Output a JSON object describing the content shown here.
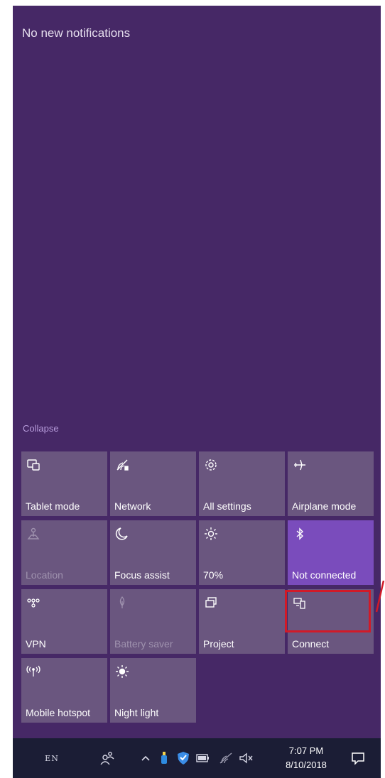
{
  "notifications": {
    "header": "No new notifications"
  },
  "collapse_label": "Collapse",
  "quick_actions": [
    {
      "label": "Tablet mode",
      "icon": "tablet-mode-icon",
      "state": "default"
    },
    {
      "label": "Network",
      "icon": "network-icon",
      "state": "default"
    },
    {
      "label": "All settings",
      "icon": "gear-icon",
      "state": "default"
    },
    {
      "label": "Airplane mode",
      "icon": "airplane-icon",
      "state": "default"
    },
    {
      "label": "Location",
      "icon": "location-icon",
      "state": "disabled"
    },
    {
      "label": "Focus assist",
      "icon": "moon-icon",
      "state": "default"
    },
    {
      "label": "70%",
      "icon": "brightness-icon",
      "state": "default"
    },
    {
      "label": "Not connected",
      "icon": "bluetooth-icon",
      "state": "active"
    },
    {
      "label": "VPN",
      "icon": "vpn-icon",
      "state": "default"
    },
    {
      "label": "Battery saver",
      "icon": "battery-saver-icon",
      "state": "disabled"
    },
    {
      "label": "Project",
      "icon": "project-icon",
      "state": "default"
    },
    {
      "label": "Connect",
      "icon": "connect-icon",
      "state": "default",
      "highlighted": true
    },
    {
      "label": "Mobile hotspot",
      "icon": "hotspot-icon",
      "state": "default"
    },
    {
      "label": "Night light",
      "icon": "night-light-icon",
      "state": "default"
    }
  ],
  "taskbar": {
    "language": "EN",
    "time": "7:07 PM",
    "date": "8/10/2018",
    "tray_icons": [
      "people-icon",
      "chevron-up-icon",
      "usb-icon",
      "defender-icon",
      "battery-icon",
      "wifi-icon",
      "volume-muted-icon"
    ],
    "action_center_icon": "action-center-icon"
  },
  "colors": {
    "panel_bg": "#462866",
    "tile_bg": "#6a567f",
    "tile_active_bg": "#7a4cbc",
    "taskbar_bg": "#1b1d35",
    "highlight": "#d11a28"
  }
}
